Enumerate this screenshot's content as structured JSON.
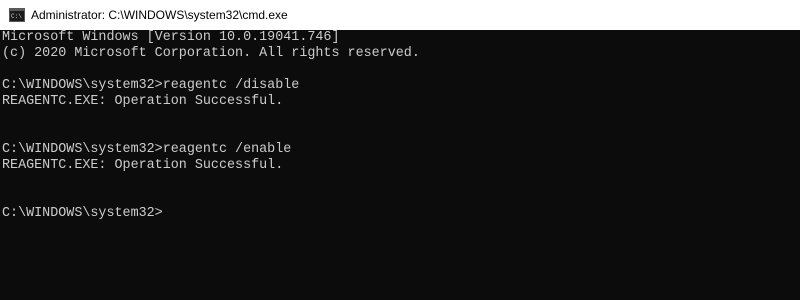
{
  "window": {
    "title": "Administrator: C:\\WINDOWS\\system32\\cmd.exe",
    "icon": "cmd-console-icon"
  },
  "console": {
    "lines": [
      "Microsoft Windows [Version 10.0.19041.746]",
      "(c) 2020 Microsoft Corporation. All rights reserved.",
      "",
      "C:\\WINDOWS\\system32>reagentc /disable",
      "REAGENTC.EXE: Operation Successful.",
      "",
      "",
      "C:\\WINDOWS\\system32>reagentc /enable",
      "REAGENTC.EXE: Operation Successful.",
      "",
      "",
      "C:\\WINDOWS\\system32>"
    ]
  },
  "colors": {
    "console_background": "#0c0c0c",
    "console_text": "#cccccc",
    "titlebar_background": "#ffffff"
  }
}
